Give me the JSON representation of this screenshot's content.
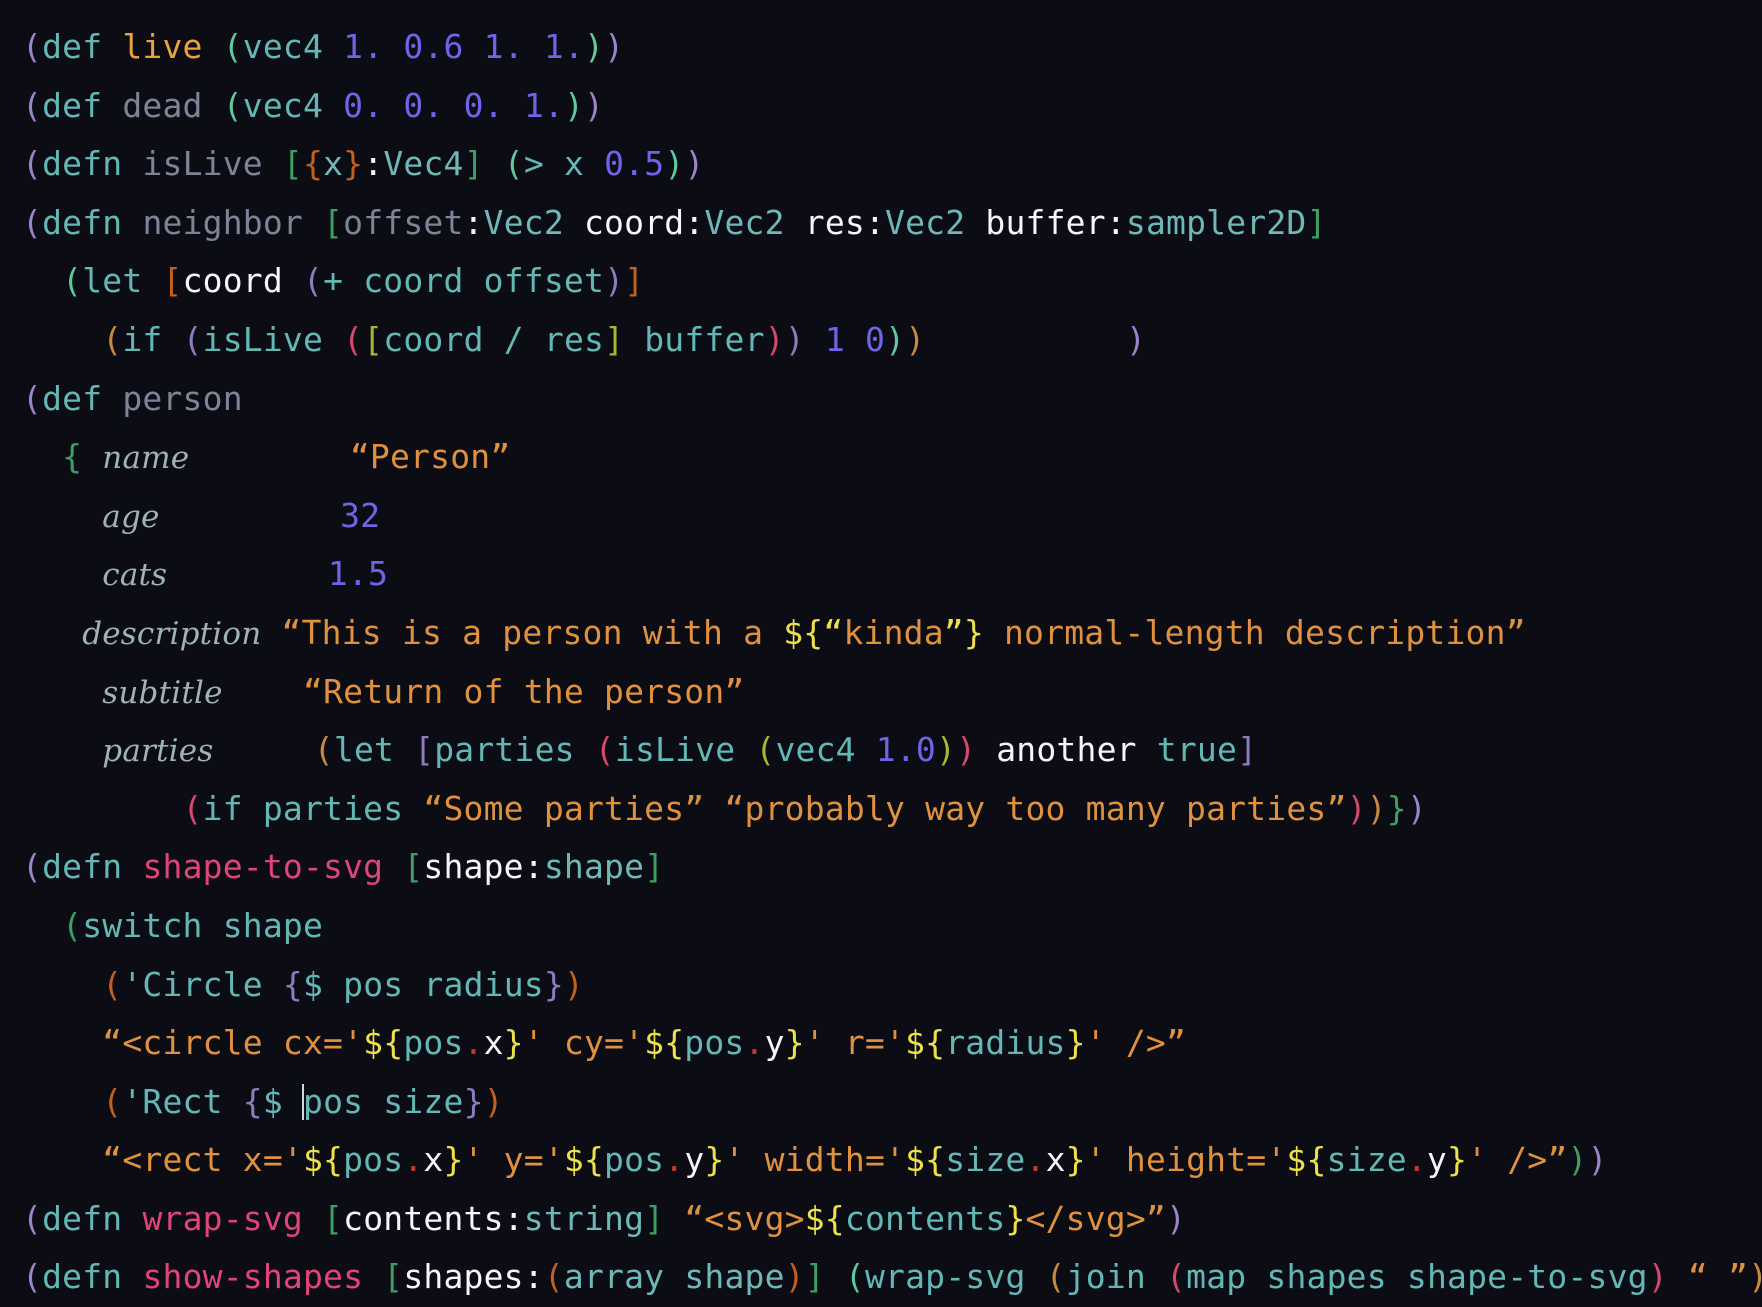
{
  "editor": {
    "language": "lisp-like-shader-dsl",
    "background_color": "#0b0c14",
    "cursor_line": 20,
    "theme_colors": {
      "keyword_teal": "#63b8b5",
      "string_orange": "#e09140",
      "interpolation_yellow": "#ece04c",
      "number_purple": "#6f63e8",
      "fn_name_yellow": "#e8a33d",
      "fn_name_pink": "#e0447b",
      "dim_identifier": "#7e8497",
      "white_text": "#f4f6fb",
      "key_label": "#9fb3b0"
    }
  },
  "code": {
    "lines": [
      "(def live (vec4 1. 0.6 1. 1.))",
      "(def dead (vec4 0. 0. 0. 1.))",
      "(defn isLive [{x}:Vec4] (> x 0.5))",
      "(defn neighbor [offset:Vec2 coord:Vec2 res:Vec2 buffer:sampler2D]",
      "  (let [coord (+ coord offset)]",
      "    (if (isLive ([coord / res] buffer)) 1 0))          )",
      "(def person",
      "  { name        “Person”",
      "    age         32",
      "    cats        1.5",
      "    description “This is a person with a ${“kinda”} normal-length description”",
      "    subtitle    “Return of the person”",
      "    parties     (let [parties (isLive (vec4 1.0)) another true]",
      "            (if parties “Some parties” “probably way too many parties”))})",
      "(defn shape-to-svg [shape:shape]",
      "  (switch shape",
      "    ('Circle {$ pos radius})",
      "    “<circle cx='${pos.x}' cy='${pos.y}' r='${radius}' />”",
      "    ('Rect {$ pos size})",
      "    “<rect x='${pos.x}' y='${pos.y}' width='${size.x}' height='${size.y}' />”))",
      "(defn wrap-svg [contents:string] “<svg>${contents}</svg>”)",
      "(defn show-shapes [shapes:(array shape)] (wrap-svg (join (map shapes shape-to-svg) “ ”)))"
    ],
    "tokens": {
      "def": "def",
      "defn": "defn",
      "let": "let",
      "if": "if",
      "switch": "switch",
      "vec4": "vec4",
      "live": "live",
      "dead": "dead",
      "isLive": "isLive",
      "neighbor": "neighbor",
      "person": "person",
      "shape_to_svg": "shape-to-svg",
      "wrap_svg": "wrap-svg",
      "show_shapes": "show-shapes",
      "coord": "coord",
      "offset": "offset",
      "res": "res",
      "buffer": "buffer",
      "another": "another",
      "true": "true",
      "parties": "parties",
      "shape": "shape",
      "pos": "pos",
      "radius": "radius",
      "size": "size",
      "contents": "contents",
      "shapes": "shapes",
      "join": "join",
      "map": "map",
      "array": "array",
      "Circle": "'Circle",
      "Rect": "'Rect"
    },
    "types": {
      "Vec2": "Vec2",
      "Vec4": "Vec4",
      "sampler2D": "sampler2D",
      "shape": "shape",
      "string": "string"
    },
    "record_keys": [
      "name",
      "age",
      "cats",
      "description",
      "subtitle",
      "parties"
    ],
    "record_values": {
      "name": "“Person”",
      "age": "32",
      "cats": "1.5",
      "description": "“This is a person with a ${“kinda”} normal-length description”",
      "subtitle": "“Return of the person”"
    },
    "strings": {
      "person": "Person",
      "kinda": "kinda",
      "description_a": "This is a person with a ",
      "description_b": " normal-length description",
      "subtitle": "Return of the person",
      "some_parties": "Some parties",
      "too_many_parties": "probably way too many parties",
      "circle_tpl": "<circle cx='${pos.x}' cy='${pos.y}' r='${radius}' />",
      "rect_tpl": "<rect x='${pos.x}' y='${pos.y}' width='${size.x}' height='${size.y}' />",
      "svg_tpl": "<svg>${contents}</svg>",
      "space": " "
    },
    "numbers": {
      "one_dot": "1.",
      "zero_six": "0.6",
      "zero_dot": "0.",
      "zero_five": "0.5",
      "one_zero": "1.0",
      "age": "32",
      "cats": "1.5",
      "one": "1",
      "zero": "0"
    }
  }
}
